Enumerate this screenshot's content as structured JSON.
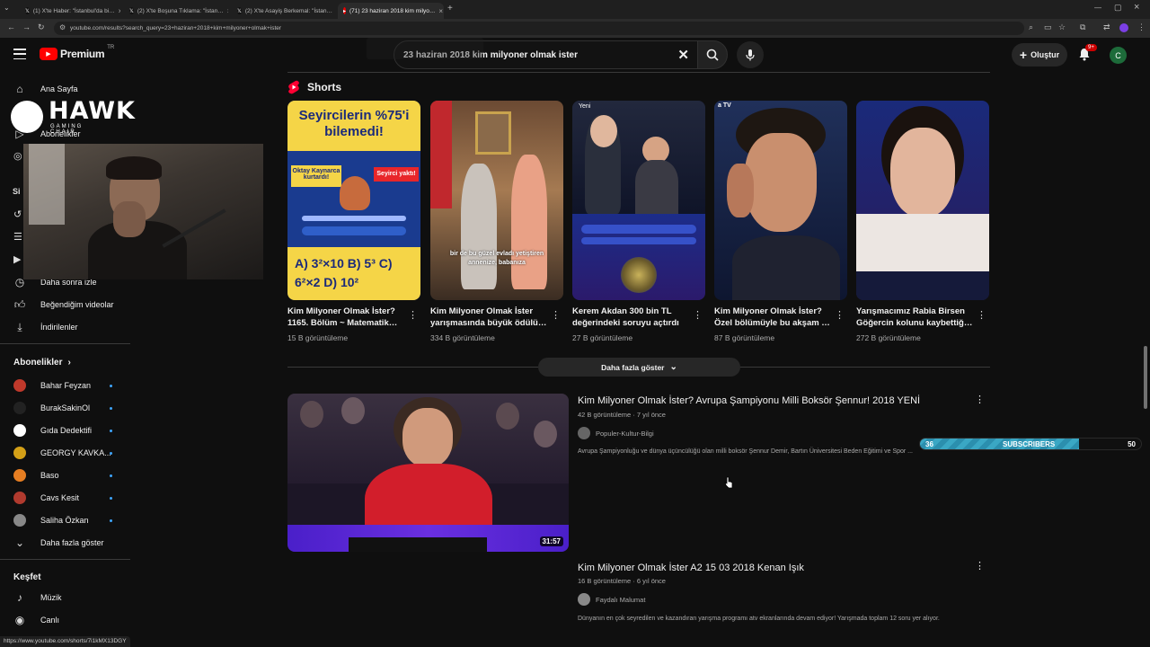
{
  "browser": {
    "tabs": [
      {
        "label": "(1) X'te Haber: \"İstanbul'da bi…",
        "icon": "x-logo-icon"
      },
      {
        "label": "(2) X'te Boşuna Tıklama: \"İstan…",
        "icon": "x-logo-icon"
      },
      {
        "label": "(2) X'te Asayiş Berkemal: \"İstan…",
        "icon": "x-logo-icon"
      },
      {
        "label": "(71) 23 haziran 2018 kim milyo…",
        "icon": "youtube-icon"
      }
    ],
    "url": "youtube.com/results?search_query=23+haziran+2018+kim+milyoner+olmak+ister",
    "status_url": "https://www.youtube.com/shorts/7i1kMX13DGY"
  },
  "header": {
    "logo_text": "Premium",
    "logo_sup": "TR",
    "search_value": "23 haziran 2018 kim milyoner olmak ister",
    "create_label": "Oluştur",
    "notif_count": "9+",
    "avatar_letter": "C"
  },
  "sidebar": {
    "top_items": [
      {
        "label": "Ana Sayfa",
        "icon": "home-icon"
      },
      {
        "label": "Abonelikler",
        "icon": "subscriptions-icon"
      }
    ],
    "you_items": [
      {
        "label": "Daha sonra izle",
        "icon": "clock-icon"
      },
      {
        "label": "Beğendiğim videolar",
        "icon": "thumbs-up-icon"
      },
      {
        "label": "İndirilenler",
        "icon": "download-icon"
      }
    ],
    "subs_title": "Abonelikler",
    "subscriptions": [
      {
        "label": "Bahar Feyzan",
        "color": "#c0392b"
      },
      {
        "label": "BurakSakinOl",
        "color": "#222222"
      },
      {
        "label": "Gıda Dedektifi",
        "color": "#ffffff"
      },
      {
        "label": "GEORGY KAVKA...",
        "color": "#d4a017"
      },
      {
        "label": "Baso",
        "color": "#e67e22"
      },
      {
        "label": "Cavs Kesit",
        "color": "#b03a2e"
      },
      {
        "label": "Saliha Özkan",
        "color": "#888888"
      }
    ],
    "show_more": "Daha fazla göster",
    "explore_title": "Keşfet",
    "explore_items": [
      {
        "label": "Müzik",
        "icon": "music-icon"
      },
      {
        "label": "Canlı",
        "icon": "live-icon"
      }
    ]
  },
  "overlay": {
    "brand": "HAWK",
    "brand_sub": "GAMING CHAIR",
    "sub_goal_current": "36",
    "sub_goal_label": "SUBSCRIBERS",
    "sub_goal_target": "50",
    "sub_goal_progress": 0.72
  },
  "shorts": {
    "section_title": "Shorts",
    "items": [
      {
        "title": "Kim Milyoner Olmak İster? 1165. Bölüm ~ Matematik…",
        "views": "15 B görüntüleme",
        "thumb_text": "Seyircilerin %75'i bilemedi!",
        "thumb_sub": "A) 3²×10   B) 5³   C) 6²×2   D) 10²"
      },
      {
        "title": "Kim Milyoner Olmak İster yarışmasında büyük ödülü…",
        "views": "334 B görüntüleme",
        "thumb_text": "bir de bu güzel evladı yetiştiren annenize, babanıza"
      },
      {
        "title": "Kerem Akdan 300 bin TL değerindeki soruyu açtırdı …",
        "views": "27 B görüntüleme",
        "thumb_text": "Yeni"
      },
      {
        "title": "Kim Milyoner Olmak İster? Özel bölümüyle bu akşam …",
        "views": "87 B görüntüleme",
        "thumb_text": ""
      },
      {
        "title": "Yarışmacımız Rabia Birsen Göğercin kolunu kaybettiğ…",
        "views": "272 B görüntüleme",
        "thumb_text": ""
      }
    ],
    "more_label": "Daha fazla göster"
  },
  "videos": [
    {
      "title": "Kim Milyoner Olmak İster? Avrupa Şampiyonu Milli Boksör Şennur! 2018 YENİ",
      "meta": "42 B görüntüleme · 7 yıl önce",
      "channel": "Populer-Kultur-Bilgi",
      "description": "Avrupa Şampiyonluğu ve dünya üçüncülüğü olan milli boksör Şennur Demir, Bartın Üniversitesi Beden Eğitimi ve Spor ...",
      "duration": "31:57"
    },
    {
      "title": "Kim Milyoner Olmak İster A2 15 03 2018 Kenan Işık",
      "meta": "16 B görüntüleme · 6 yıl önce",
      "channel": "Faydalı Malumat",
      "description": "Dünyanın en çok seyredilen ve kazandıran yarışma programı atv ekranlarında devam ediyor! Yarışmada toplam 12 soru yer alıyor."
    }
  ]
}
